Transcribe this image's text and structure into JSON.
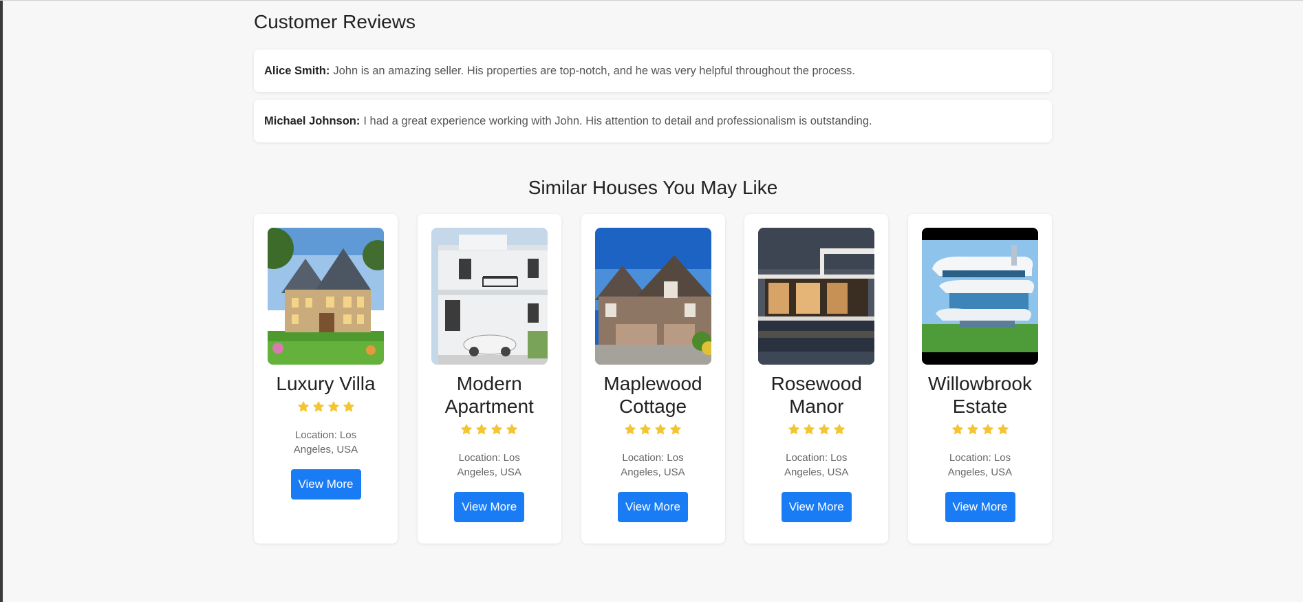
{
  "reviews": {
    "title": "Customer Reviews",
    "items": [
      {
        "author": "Alice Smith:",
        "text": "John is an amazing seller. His properties are top-notch, and he was very helpful throughout the process."
      },
      {
        "author": "Michael Johnson:",
        "text": "I had a great experience working with John. His attention to detail and professionalism is outstanding."
      }
    ]
  },
  "similar": {
    "title": "Similar Houses You May Like",
    "star_color": "#f4c531",
    "button_color": "#1a7cf5",
    "cards": [
      {
        "name": "Luxury Villa",
        "stars": 4,
        "location": "Location: Los Angeles, USA",
        "button": "View More"
      },
      {
        "name": "Modern Apartment",
        "stars": 4,
        "location": "Location: Los Angeles, USA",
        "button": "View More"
      },
      {
        "name": "Maplewood Cottage",
        "stars": 4,
        "location": "Location: Los Angeles, USA",
        "button": "View More"
      },
      {
        "name": "Rosewood Manor",
        "stars": 4,
        "location": "Location: Los Angeles, USA",
        "button": "View More"
      },
      {
        "name": "Willowbrook Estate",
        "stars": 4,
        "location": "Location: Los Angeles, USA",
        "button": "View More"
      }
    ]
  }
}
